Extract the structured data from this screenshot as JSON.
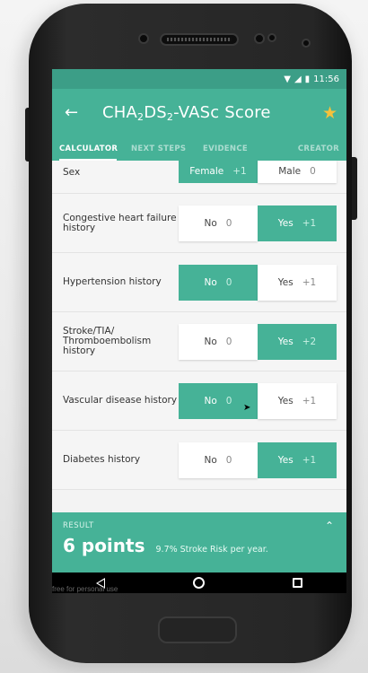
{
  "status": {
    "time": "11:56"
  },
  "appbar": {
    "title_main": "CHA",
    "title_sub1": "2",
    "title_mid": "DS",
    "title_sub2": "2",
    "title_end": "-VASc Score"
  },
  "tabs": [
    "CALCULATOR",
    "NEXT STEPS",
    "EVIDENCE",
    "CREATOR"
  ],
  "rows": [
    {
      "label": "Sex",
      "a": "Female",
      "a_pts": "+1",
      "b": "Male",
      "b_pts": "0",
      "selected": "a"
    },
    {
      "label": "Congestive heart failure history",
      "a": "No",
      "a_pts": "0",
      "b": "Yes",
      "b_pts": "+1",
      "selected": "b"
    },
    {
      "label": "Hypertension history",
      "a": "No",
      "a_pts": "0",
      "b": "Yes",
      "b_pts": "+1",
      "selected": "a"
    },
    {
      "label": "Stroke/TIA/ Thromboembolism history",
      "a": "No",
      "a_pts": "0",
      "b": "Yes",
      "b_pts": "+2",
      "selected": "b"
    },
    {
      "label": "Vascular disease history",
      "a": "No",
      "a_pts": "0",
      "b": "Yes",
      "b_pts": "+1",
      "selected": "a"
    },
    {
      "label": "Diabetes history",
      "a": "No",
      "a_pts": "0",
      "b": "Yes",
      "b_pts": "+1",
      "selected": "b"
    }
  ],
  "result": {
    "label": "RESULT",
    "points": "6 points",
    "risk": "9.7% Stroke Risk per year."
  },
  "watermark": "free for personal use",
  "colors": {
    "accent": "#46b297",
    "statusbar": "#3c9e87",
    "star": "#f6c13b"
  },
  "icons": {
    "back": "arrow-left-icon",
    "favorite": "star-icon",
    "expand": "chevron-up-icon"
  }
}
